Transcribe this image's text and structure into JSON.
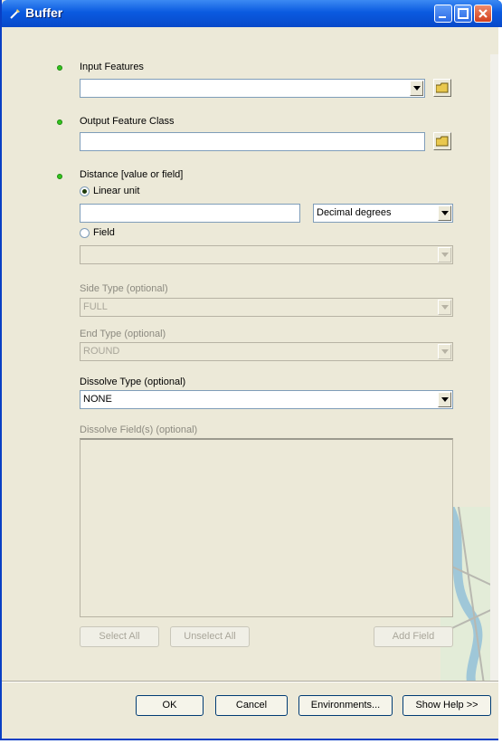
{
  "window": {
    "title": "Buffer"
  },
  "input_features": {
    "label": "Input Features",
    "value": ""
  },
  "output_feature_class": {
    "label": "Output Feature Class",
    "value": ""
  },
  "distance": {
    "label": "Distance [value or field]",
    "linear_unit_label": "Linear unit",
    "linear_unit_selected": true,
    "linear_unit_value": "",
    "unit_select": "Decimal degrees",
    "field_label": "Field",
    "field_value": ""
  },
  "side_type": {
    "label": "Side Type (optional)",
    "value": "FULL"
  },
  "end_type": {
    "label": "End Type (optional)",
    "value": "ROUND"
  },
  "dissolve_type": {
    "label": "Dissolve Type (optional)",
    "value": "NONE"
  },
  "dissolve_fields": {
    "label": "Dissolve Field(s) (optional)",
    "select_all": "Select All",
    "unselect_all": "Unselect All",
    "add_field": "Add Field"
  },
  "footer": {
    "ok": "OK",
    "cancel": "Cancel",
    "environments": "Environments...",
    "show_help": "Show Help >>"
  },
  "colors": {
    "title_bar": "#0a5ae0",
    "dialog_bg": "#ece9d8",
    "required_dot": "#34c51e"
  }
}
